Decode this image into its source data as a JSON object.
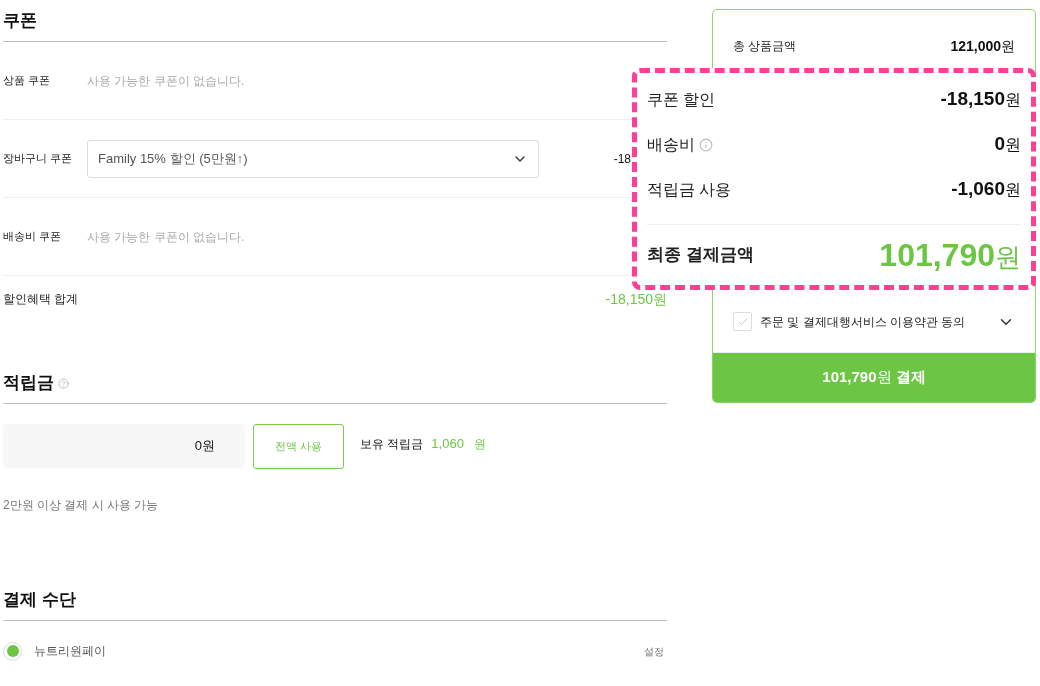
{
  "coupon_section": {
    "title": "쿠폰",
    "rows": [
      {
        "kind": "text",
        "label": "상품 쿠폰",
        "note": "사용 가능한 쿠폰이 없습니다."
      },
      {
        "kind": "select",
        "label": "장바구니 쿠폰",
        "value": "Family 15% 할인 (5만원↑)",
        "amount": "-18"
      },
      {
        "kind": "text",
        "label": "배송비 쿠폰",
        "note": "사용 가능한 쿠폰이 없습니다."
      }
    ],
    "total": {
      "label": "할인혜택 합계",
      "value": "-18,150원"
    }
  },
  "points_section": {
    "title": "적립금",
    "input_value": "0원",
    "use_all_button": "전액 사용",
    "balance_label": "보유 적립금",
    "balance_value": "1,060",
    "balance_unit": "원",
    "note": "2만원 이상 결제 시 사용 가능"
  },
  "payment_section": {
    "title": "결제 수단",
    "methods": [
      {
        "label": "뉴트리원페이",
        "selected": true,
        "action": "설정"
      }
    ]
  },
  "summary_card": {
    "total_label": "총 상품금액",
    "total_value": "121,000",
    "total_unit": "원",
    "agreement": {
      "label": "주문 및 결제대행서비스 이용약관 동의",
      "checked": false
    },
    "pay_button": "**101,790**원 **결제**"
  },
  "callout": {
    "rows": [
      {
        "label": "쿠폰 할인",
        "value": "-18,150",
        "unit": "원",
        "info": false
      },
      {
        "label": "배송비",
        "value": "0",
        "unit": "원",
        "info": true
      },
      {
        "label": "적립금 사용",
        "value": "-1,060",
        "unit": "원",
        "info": false
      }
    ],
    "final": {
      "label": "최종 결제금액",
      "value": "101,790",
      "unit": "원"
    }
  }
}
